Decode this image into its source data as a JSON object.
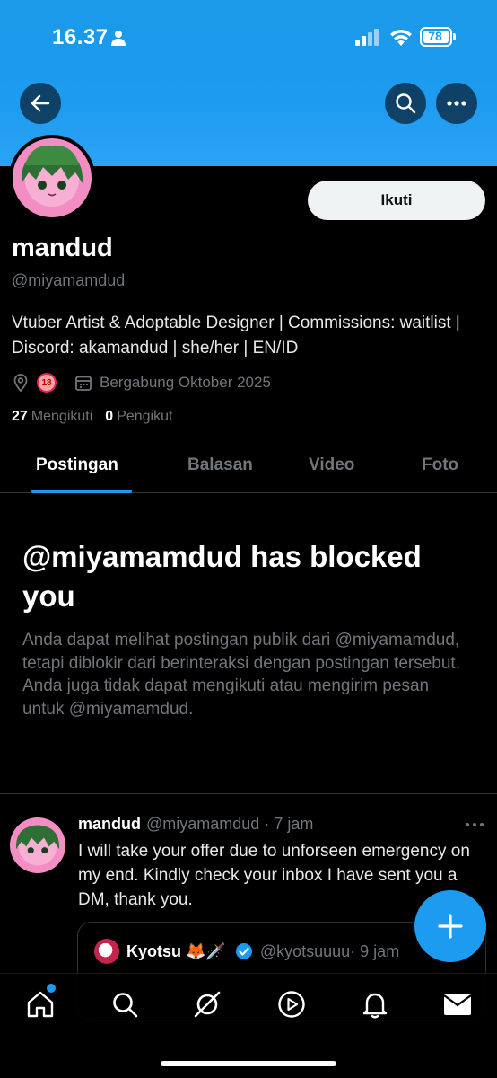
{
  "status_bar": {
    "time": "16.37",
    "battery": "78"
  },
  "header": {
    "back_icon": "arrow-left-icon",
    "search_icon": "search-icon",
    "more_icon": "ellipsis-icon"
  },
  "profile": {
    "follow_label": "Ikuti",
    "name": "mandud",
    "handle": "@miyamamdud",
    "bio": "Vtuber Artist & Adoptable Designer | Commissions: waitlist | Discord: akamandud | she/her | EN/ID",
    "age_badge": "18",
    "joined": "Bergabung Oktober 2025",
    "following_count": "27",
    "following_label": "Mengikuti",
    "followers_count": "0",
    "followers_label": "Pengikut"
  },
  "tabs": [
    {
      "label": "Postingan"
    },
    {
      "label": "Balasan"
    },
    {
      "label": "Video"
    },
    {
      "label": "Foto"
    }
  ],
  "blocked": {
    "title": "@miyamamdud has blocked you",
    "description": "Anda dapat melihat postingan publik dari @miyamamdud, tetapi diblokir dari berinteraksi dengan postingan tersebut. Anda juga tidak dapat mengikuti atau mengirim pesan untuk @miyamamdud."
  },
  "post": {
    "name": "mandud",
    "handle": "@miyamamdud",
    "time": "· 7 jam",
    "text": "I will take your offer due to unforseen emergency on my end. Kindly check your inbox I have sent you a DM, thank you.",
    "quote": {
      "name": "Kyotsu 🦊🗡️",
      "handle": "@kyotsuuuu",
      "time": "· 9 jam"
    }
  },
  "colors": {
    "accent": "#1d9bf0",
    "background": "#000000",
    "muted": "#71767b"
  },
  "bottom_nav": [
    "home-icon",
    "search-icon",
    "grok-icon",
    "video-icon",
    "notifications-icon",
    "messages-icon"
  ]
}
